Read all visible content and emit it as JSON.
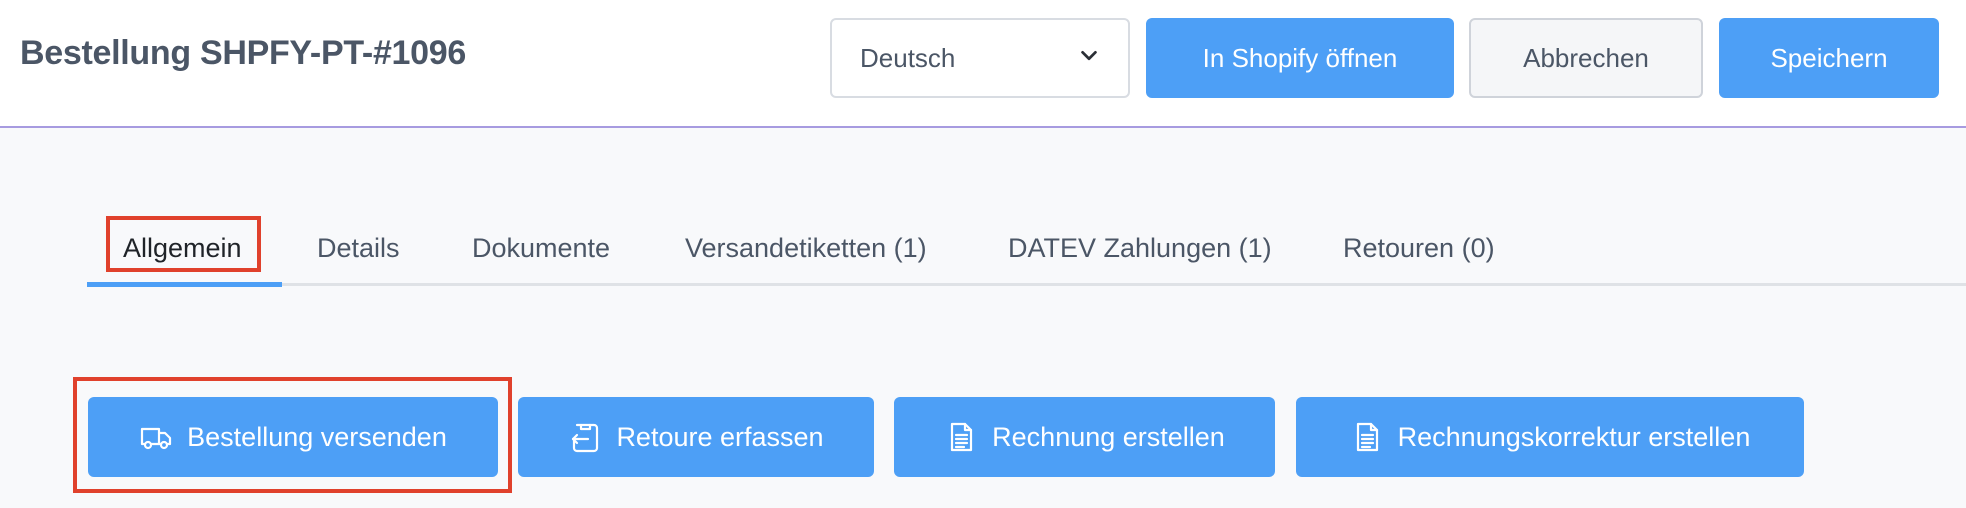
{
  "header": {
    "title": "Bestellung SHPFY-PT-#1096",
    "language_select": {
      "value": "Deutsch"
    },
    "open_in_shopify_label": "In Shopify öffnen",
    "cancel_label": "Abbrechen",
    "save_label": "Speichern"
  },
  "tabs": [
    {
      "label": "Allgemein",
      "active": true
    },
    {
      "label": "Details"
    },
    {
      "label": "Dokumente"
    },
    {
      "label": "Versandetiketten (1)"
    },
    {
      "label": "DATEV Zahlungen (1)"
    },
    {
      "label": "Retouren (0)"
    }
  ],
  "actions": [
    {
      "label": "Bestellung versenden",
      "icon": "truck-icon"
    },
    {
      "label": "Retoure erfassen",
      "icon": "return-icon"
    },
    {
      "label": "Rechnung erstellen",
      "icon": "document-icon"
    },
    {
      "label": "Rechnungskorrektur erstellen",
      "icon": "document-icon"
    }
  ],
  "colors": {
    "primary": "#4d9ff6",
    "highlight": "#e0412c",
    "text": "#4b5666",
    "header_border": "#a79be0"
  }
}
